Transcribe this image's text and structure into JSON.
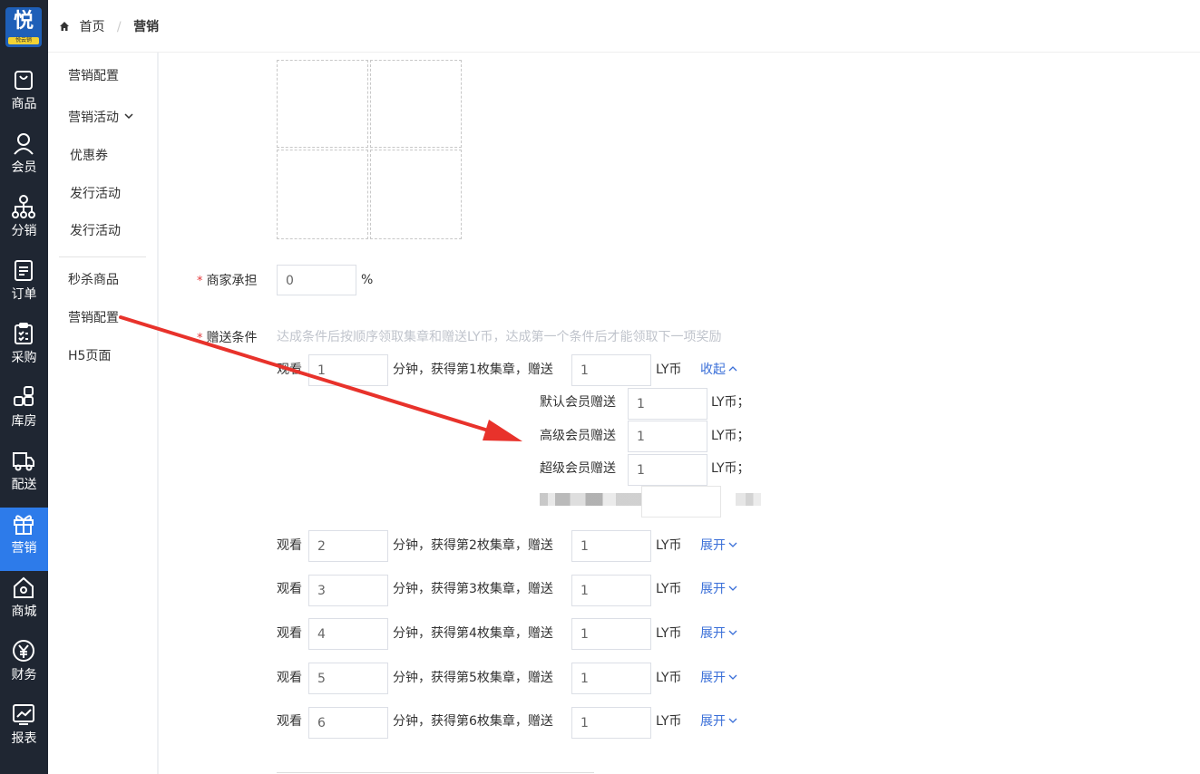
{
  "app": {
    "logo_char": "悦",
    "logo_tag": "悦云销"
  },
  "rail": {
    "items": [
      {
        "label": "商品",
        "icon": "bag-icon"
      },
      {
        "label": "会员",
        "icon": "user-icon"
      },
      {
        "label": "分销",
        "icon": "hierarchy-icon"
      },
      {
        "label": "订单",
        "icon": "document-icon"
      },
      {
        "label": "采购",
        "icon": "clipboard-icon"
      },
      {
        "label": "库房",
        "icon": "grid-icon"
      },
      {
        "label": "配送",
        "icon": "truck-icon"
      },
      {
        "label": "营销",
        "icon": "gift-icon",
        "active": true
      },
      {
        "label": "商城",
        "icon": "store-icon"
      },
      {
        "label": "财务",
        "icon": "yen-icon"
      },
      {
        "label": "报表",
        "icon": "chart-icon"
      }
    ]
  },
  "breadcrumb": {
    "home": "首页",
    "separator": "/",
    "current": "营销"
  },
  "submenu": {
    "items": [
      {
        "label": "营销配置"
      },
      {
        "label": "营销活动"
      },
      {
        "label": "优惠券"
      },
      {
        "label": "发行活动"
      },
      {
        "label": "发行活动"
      },
      {
        "label": "秒杀商品"
      },
      {
        "label": "营销配置"
      },
      {
        "label": "H5页面"
      }
    ]
  },
  "form": {
    "merchant_share": {
      "label": "商家承担",
      "value": "0",
      "unit": "%"
    },
    "gift_condition": {
      "label": "赠送条件",
      "hint": "达成条件后按顺序领取集章和赠送LY币，达成第一个条件后才能领取下一项奖励",
      "watch_label": "观看",
      "rows": [
        {
          "minutes": "1",
          "middle": "分钟，获得第1枚集章，赠送",
          "coins": "1",
          "unit": "LY币",
          "toggle": "收起"
        },
        {
          "minutes": "2",
          "middle": "分钟，获得第2枚集章，赠送",
          "coins": "1",
          "unit": "LY币",
          "toggle": "展开"
        },
        {
          "minutes": "3",
          "middle": "分钟，获得第3枚集章，赠送",
          "coins": "1",
          "unit": "LY币",
          "toggle": "展开"
        },
        {
          "minutes": "4",
          "middle": "分钟，获得第4枚集章，赠送",
          "coins": "1",
          "unit": "LY币",
          "toggle": "展开"
        },
        {
          "minutes": "5",
          "middle": "分钟，获得第5枚集章，赠送",
          "coins": "1",
          "unit": "LY币",
          "toggle": "展开"
        },
        {
          "minutes": "6",
          "middle": "分钟，获得第6枚集章，赠送",
          "coins": "1",
          "unit": "LY币",
          "toggle": "展开"
        }
      ],
      "member_tiers": [
        {
          "label": "默认会员赠送",
          "value": "1",
          "unit": "LY币；"
        },
        {
          "label": "高级会员赠送",
          "value": "1",
          "unit": "LY币；"
        },
        {
          "label": "超级会员赠送",
          "value": "1",
          "unit": "LY币；"
        }
      ]
    }
  },
  "colors": {
    "rail_bg": "#1f2632",
    "rail_active": "#2d7bea",
    "link": "#3a6fd8",
    "required": "#e4393c",
    "arrow": "#e8322b"
  }
}
